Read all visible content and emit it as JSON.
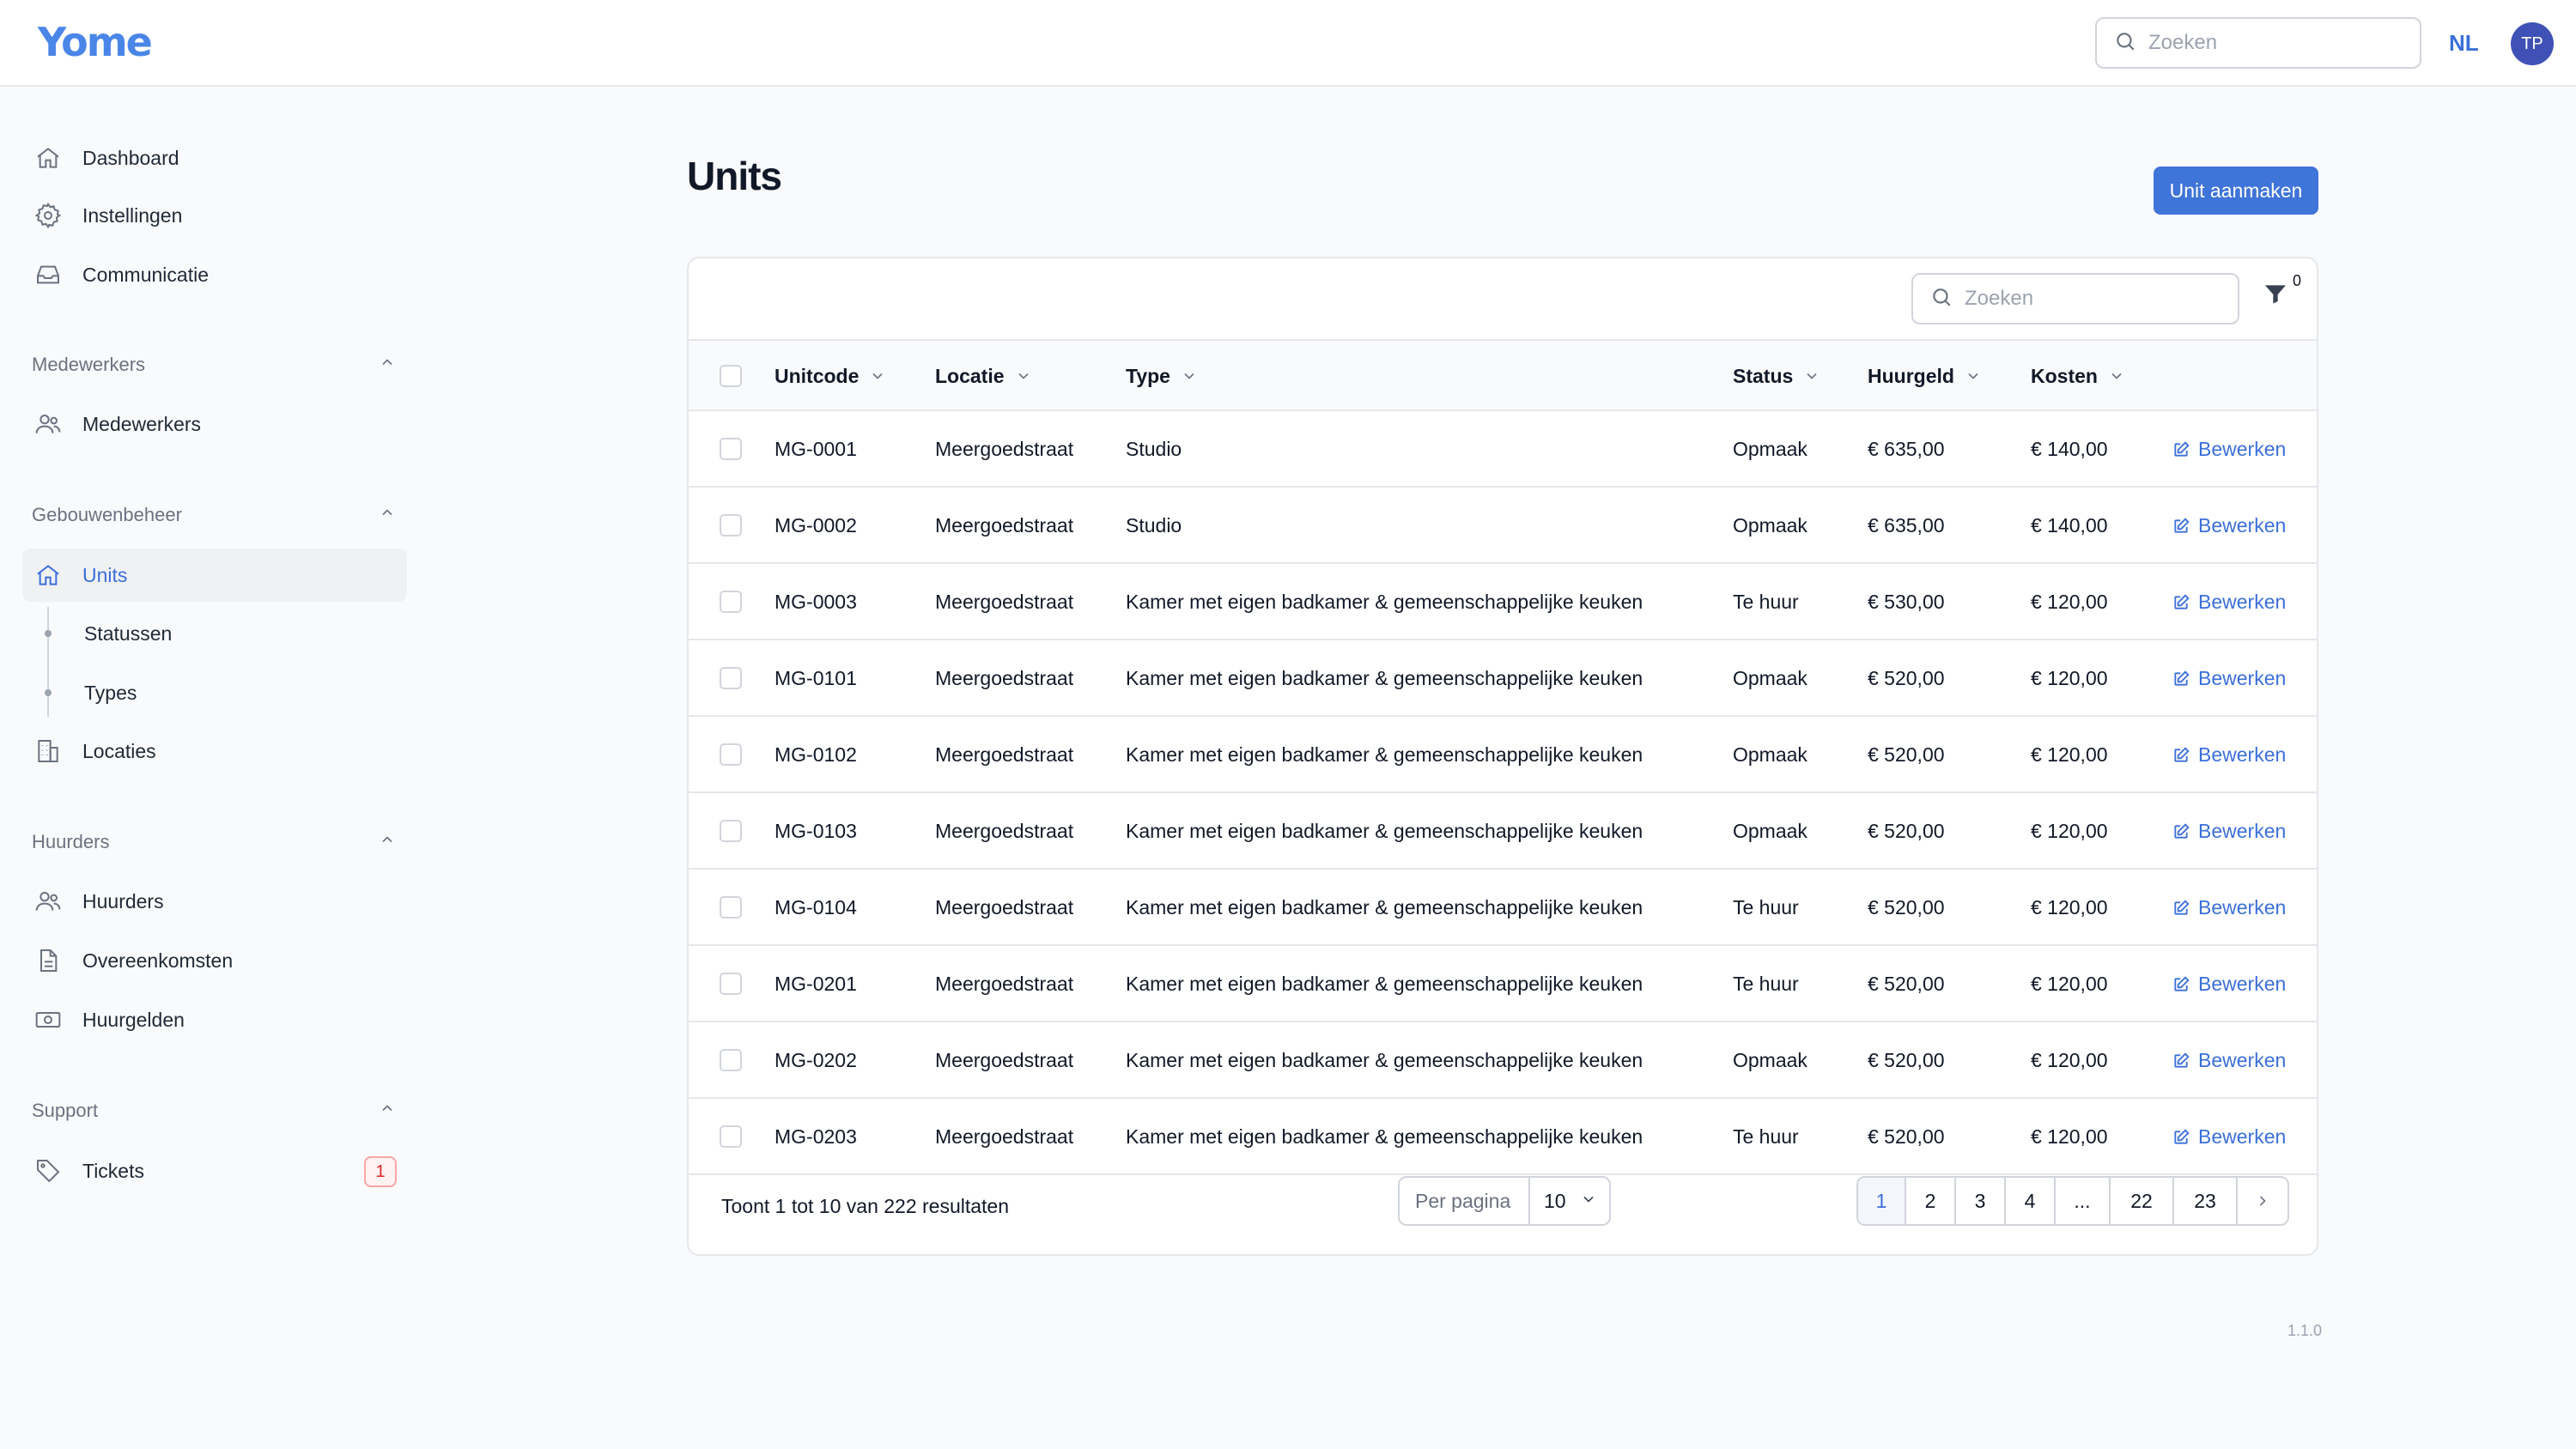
{
  "header": {
    "logo_text": "Yome",
    "search_placeholder": "Zoeken",
    "language": "NL",
    "avatar_initials": "TP"
  },
  "sidebar": {
    "top_items": [
      {
        "label": "Dashboard",
        "icon": "home-icon"
      },
      {
        "label": "Instellingen",
        "icon": "gear-icon"
      },
      {
        "label": "Communicatie",
        "icon": "inbox-icon"
      }
    ],
    "sections": [
      {
        "title": "Medewerkers",
        "items": [
          {
            "label": "Medewerkers",
            "icon": "users-icon"
          }
        ]
      },
      {
        "title": "Gebouwenbeheer",
        "items": [
          {
            "label": "Units",
            "icon": "home-icon",
            "active": true
          },
          {
            "label": "Statussen",
            "sub": true
          },
          {
            "label": "Types",
            "sub": true
          },
          {
            "label": "Locaties",
            "icon": "building-icon"
          }
        ]
      },
      {
        "title": "Huurders",
        "items": [
          {
            "label": "Huurders",
            "icon": "users-icon"
          },
          {
            "label": "Overeenkomsten",
            "icon": "document-icon"
          },
          {
            "label": "Huurgelden",
            "icon": "banknote-icon"
          }
        ]
      },
      {
        "title": "Support",
        "items": [
          {
            "label": "Tickets",
            "icon": "tag-icon",
            "badge": "1"
          }
        ]
      }
    ]
  },
  "main": {
    "title": "Units",
    "create_button": "Unit aanmaken",
    "table_search_placeholder": "Zoeken",
    "filter_count": "0",
    "columns": [
      "Unitcode",
      "Locatie",
      "Type",
      "Status",
      "Huurgeld",
      "Kosten"
    ],
    "edit_label": "Bewerken",
    "rows": [
      {
        "code": "MG-0001",
        "locatie": "Meergoedstraat",
        "type": "Studio",
        "status": "Opmaak",
        "huurgeld": "€ 635,00",
        "kosten": "€ 140,00"
      },
      {
        "code": "MG-0002",
        "locatie": "Meergoedstraat",
        "type": "Studio",
        "status": "Opmaak",
        "huurgeld": "€ 635,00",
        "kosten": "€ 140,00"
      },
      {
        "code": "MG-0003",
        "locatie": "Meergoedstraat",
        "type": "Kamer met eigen badkamer & gemeenschappelijke keuken",
        "status": "Te huur",
        "huurgeld": "€ 530,00",
        "kosten": "€ 120,00"
      },
      {
        "code": "MG-0101",
        "locatie": "Meergoedstraat",
        "type": "Kamer met eigen badkamer & gemeenschappelijke keuken",
        "status": "Opmaak",
        "huurgeld": "€ 520,00",
        "kosten": "€ 120,00"
      },
      {
        "code": "MG-0102",
        "locatie": "Meergoedstraat",
        "type": "Kamer met eigen badkamer & gemeenschappelijke keuken",
        "status": "Opmaak",
        "huurgeld": "€ 520,00",
        "kosten": "€ 120,00"
      },
      {
        "code": "MG-0103",
        "locatie": "Meergoedstraat",
        "type": "Kamer met eigen badkamer & gemeenschappelijke keuken",
        "status": "Opmaak",
        "huurgeld": "€ 520,00",
        "kosten": "€ 120,00"
      },
      {
        "code": "MG-0104",
        "locatie": "Meergoedstraat",
        "type": "Kamer met eigen badkamer & gemeenschappelijke keuken",
        "status": "Te huur",
        "huurgeld": "€ 520,00",
        "kosten": "€ 120,00"
      },
      {
        "code": "MG-0201",
        "locatie": "Meergoedstraat",
        "type": "Kamer met eigen badkamer & gemeenschappelijke keuken",
        "status": "Te huur",
        "huurgeld": "€ 520,00",
        "kosten": "€ 120,00"
      },
      {
        "code": "MG-0202",
        "locatie": "Meergoedstraat",
        "type": "Kamer met eigen badkamer & gemeenschappelijke keuken",
        "status": "Opmaak",
        "huurgeld": "€ 520,00",
        "kosten": "€ 120,00"
      },
      {
        "code": "MG-0203",
        "locatie": "Meergoedstraat",
        "type": "Kamer met eigen badkamer & gemeenschappelijke keuken",
        "status": "Te huur",
        "huurgeld": "€ 520,00",
        "kosten": "€ 120,00"
      }
    ],
    "footer": {
      "results_text": "Toont 1 tot 10 van 222 resultaten",
      "per_page_label": "Per pagina",
      "per_page_value": "10",
      "pages": [
        "1",
        "2",
        "3",
        "4",
        "...",
        "22",
        "23"
      ],
      "current_page": "1"
    }
  },
  "version": "1.1.0",
  "colors": {
    "accent": "#3f74d8",
    "link": "#3b6fd9",
    "badge": "#dc2626"
  }
}
